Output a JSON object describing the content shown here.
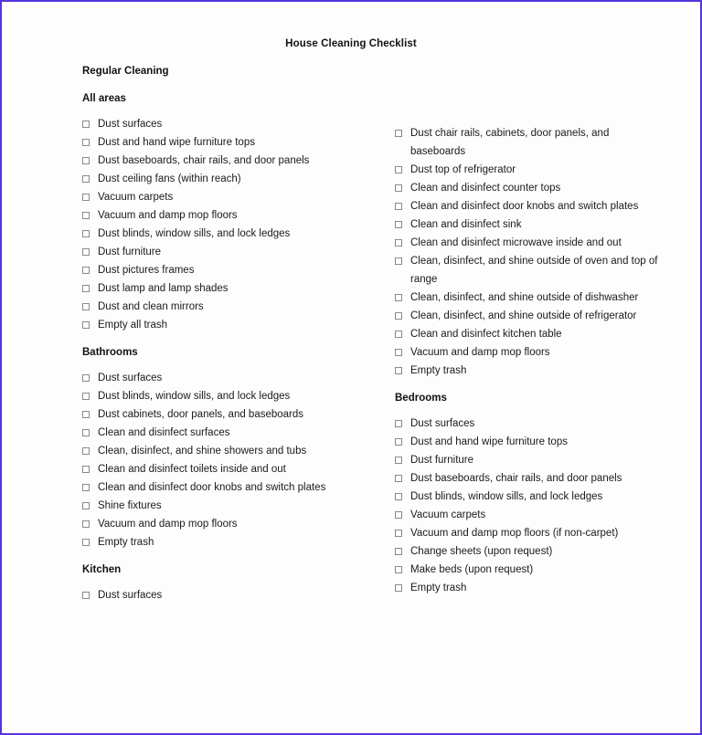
{
  "document": {
    "title": "House Cleaning Checklist",
    "main_heading": "Regular Cleaning"
  },
  "sections": {
    "all_areas": {
      "heading": "All areas",
      "items": [
        "Dust surfaces",
        "Dust and hand wipe furniture tops",
        "Dust baseboards, chair rails, and door panels",
        "Dust ceiling fans (within reach)",
        "Vacuum carpets",
        "Vacuum and damp mop floors",
        "Dust blinds, window sills, and lock ledges",
        "Dust furniture",
        "Dust pictures frames",
        "Dust lamp and lamp shades",
        "Dust and clean mirrors",
        "Empty all trash"
      ]
    },
    "bathrooms": {
      "heading": "Bathrooms",
      "items": [
        "Dust surfaces",
        "Dust blinds, window sills, and lock ledges",
        "Dust cabinets, door panels, and baseboards",
        "Clean and disinfect surfaces",
        "Clean, disinfect, and shine showers and tubs",
        "Clean and disinfect toilets inside and out",
        "Clean and disinfect door knobs and switch plates",
        "Shine fixtures",
        "Vacuum and damp mop floors",
        "Empty trash"
      ]
    },
    "kitchen": {
      "heading": "Kitchen",
      "items_left": [
        "Dust surfaces"
      ],
      "items_right": [
        "Dust chair rails, cabinets, door panels, and baseboards",
        "Dust top of refrigerator",
        "Clean and disinfect counter tops",
        "Clean and disinfect door knobs and switch plates",
        "Clean and disinfect sink",
        "Clean and disinfect microwave inside and out",
        "Clean, disinfect, and shine outside of oven and top of range",
        "Clean, disinfect, and shine outside of dishwasher",
        "Clean, disinfect, and shine outside of refrigerator",
        "Clean and disinfect kitchen table",
        "Vacuum and damp mop floors",
        "Empty trash"
      ]
    },
    "bedrooms": {
      "heading": "Bedrooms",
      "items": [
        "Dust surfaces",
        "Dust and hand wipe furniture tops",
        "Dust furniture",
        "Dust baseboards, chair rails, and door panels",
        "Dust blinds, window sills, and lock ledges",
        "Vacuum carpets",
        "Vacuum and damp mop floors (if non-carpet)",
        "Change sheets (upon request)",
        "Make beds (upon request)",
        "Empty trash"
      ]
    }
  },
  "style": {
    "border_color": "#5634db",
    "text_color": "#1a1a1a",
    "checkbox_border": "#8a8a8a",
    "page_background": "#fdfdfe"
  }
}
